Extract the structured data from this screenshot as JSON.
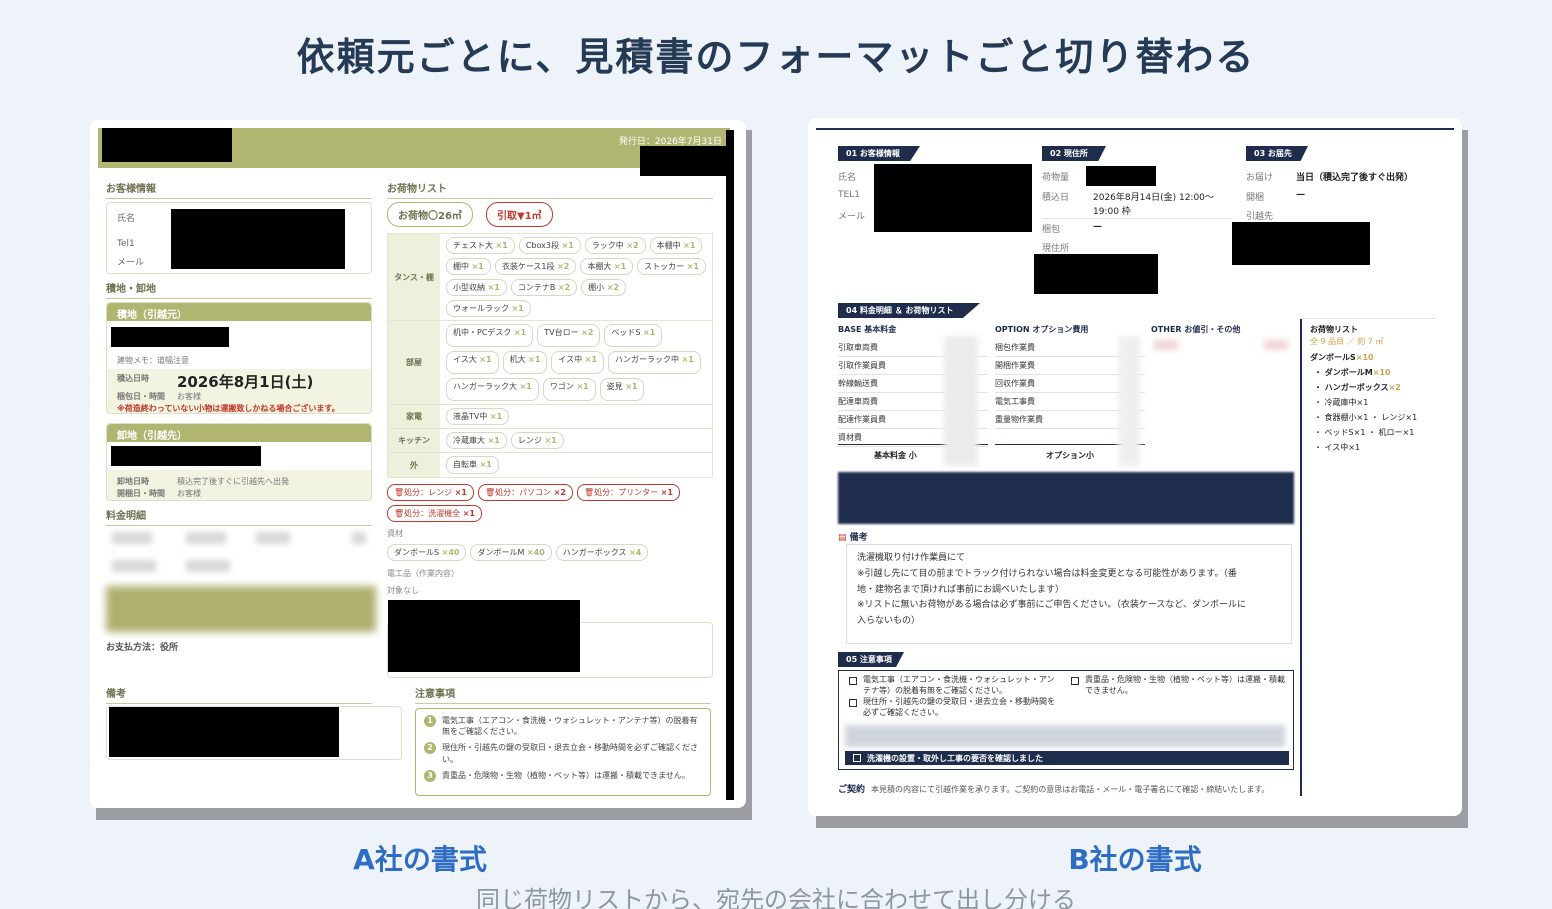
{
  "headline": "依頼元ごとに、見積書のフォーマットごと切り替わる",
  "caption_a": "A社の書式",
  "caption_b": "B社の書式",
  "subline": "同じ荷物リストから、宛先の会社に合わせて出し分ける",
  "colors": {
    "olive": "#b1b572",
    "navy": "#1f2d4d",
    "caption_blue": "#2e6dc4",
    "warn_red": "#c0392b"
  },
  "a": {
    "issue_date": "発行日：2026年7月31日",
    "customer_title": "お客様情報",
    "name_label": "氏名",
    "tel_label": "Tel1",
    "mail_label": "メール",
    "loading_title": "積地・卸地",
    "origin_title": "積地（引越元）",
    "memo": "建物メモ：道幅注意",
    "load_datetime_label": "積込日時",
    "load_date": "2026年8月1日(土)",
    "pack_label": "梱包日・時間",
    "pack_value": "お客様",
    "warning": "※荷造終わっていない小物は運搬致しかねる場合ございます。",
    "dest_title": "卸地（引越先）",
    "unload_label": "卸地日時",
    "unload_value": "積込完了後すぐに引越先へ出発",
    "unpack_label": "開梱日・時間",
    "unpack_value": "お客様",
    "fee_title": "料金明細",
    "payment": "お支払方法：役所",
    "remarks_title": "備考",
    "cargo_title": "お荷物リスト",
    "pill_cargo": "お荷物〇26㎥",
    "pill_reduce": "引取▼1㎥",
    "grid": [
      {
        "category": "タンス・棚",
        "items": [
          {
            "name": "チェスト大",
            "qty": "×1"
          },
          {
            "name": "Cbox3段",
            "qty": "×1"
          },
          {
            "name": "ラック中",
            "qty": "×2"
          },
          {
            "name": "本棚中",
            "qty": "×1"
          },
          {
            "name": "棚中",
            "qty": "×1"
          },
          {
            "name": "衣装ケース1段",
            "qty": "×2"
          },
          {
            "name": "本棚大",
            "qty": "×1"
          },
          {
            "name": "ストッカー",
            "qty": "×1"
          },
          {
            "name": "小型収納",
            "qty": "×1"
          },
          {
            "name": "コンテナB",
            "qty": "×2"
          },
          {
            "name": "棚小",
            "qty": "×2"
          },
          {
            "name": "ウォールラック",
            "qty": "×1"
          }
        ]
      },
      {
        "category": "部屋",
        "items": [
          {
            "name": "机中・PCデスク",
            "qty": "×1"
          },
          {
            "name": "TV台ロー",
            "qty": "×2"
          },
          {
            "name": "ベッドS",
            "qty": "×1"
          },
          {
            "name": "イス大",
            "qty": "×1"
          },
          {
            "name": "机大",
            "qty": "×1"
          },
          {
            "name": "イス中",
            "qty": "×1"
          },
          {
            "name": "ハンガーラック中",
            "qty": "×1"
          },
          {
            "name": "ハンガーラック大",
            "qty": "×1"
          },
          {
            "name": "ワゴン",
            "qty": "×1"
          },
          {
            "name": "姿見",
            "qty": "×1"
          }
        ]
      },
      {
        "category": "家電",
        "items": [
          {
            "name": "液晶TV中",
            "qty": "×1"
          }
        ]
      },
      {
        "category": "キッチン",
        "items": [
          {
            "name": "冷蔵庫大",
            "qty": "×1"
          },
          {
            "name": "レンジ",
            "qty": "×1"
          }
        ]
      },
      {
        "category": "外",
        "items": [
          {
            "name": "自転車",
            "qty": "×1"
          }
        ]
      }
    ],
    "disposal": [
      {
        "name": "🗑処分：レンジ",
        "qty": "×1"
      },
      {
        "name": "🗑処分：パソコン",
        "qty": "×2"
      },
      {
        "name": "🗑処分：プリンター",
        "qty": "×1"
      },
      {
        "name": "🗑処分：洗濯機全",
        "qty": "×1"
      }
    ],
    "materials_label": "資材",
    "materials": [
      {
        "name": "ダンボールS",
        "qty": "×40"
      },
      {
        "name": "ダンボールM",
        "qty": "×40"
      },
      {
        "name": "ハンガーボックス",
        "qty": "×4"
      }
    ],
    "electric_label": "電工品（作業内容）",
    "electric_value": "対象なし",
    "caution_title": "注意事項",
    "cautions": [
      {
        "n": "1",
        "text": "電気工事（エアコン・食洗機・ウォシュレット・アンテナ等）の脱着有無をご確認ください。"
      },
      {
        "n": "2",
        "text": "現住所・引越先の鍵の受取日・退去立会・移動時間を必ずご確認ください。"
      },
      {
        "n": "3",
        "text": "貴重品・危険物・生物（植物・ペット等）は運搬・積載できません。"
      }
    ]
  },
  "b": {
    "tag1": "01 お客様情報",
    "tag2": "02 現住所",
    "tag3": "03 お届先",
    "name_label": "氏名",
    "tel_label": "TEL1",
    "mail_label": "メール",
    "cargo_amount_label": "荷物量",
    "load_label": "積込日",
    "load_value_1": "2026年8月14日(金) 12:00〜",
    "load_value_2": "19:00 枠",
    "pack_label": "梱包",
    "pack_value": "—",
    "current_label": "現住所",
    "deliver_label": "お届け",
    "deliver_value": "当日（積込完了後すぐ出発）",
    "unpack_label": "開梱",
    "unpack_value": "—",
    "dest_label": "引越先",
    "tag4": "04 料金明細 ＆ お荷物リスト",
    "base_head": "BASE 基本料金",
    "base_items": [
      "引取車両費",
      "引取作業員費",
      "幹線輸送費",
      "配達車両費",
      "配達作業員費",
      "資材費"
    ],
    "base_sub": "基本料金 小",
    "option_head": "OPTION オプション費用",
    "option_items": [
      "梱包作業費",
      "開梱作業費",
      "回収作業費",
      "電気工事費",
      "重量物作業費"
    ],
    "option_sub": "オプション小",
    "other_head": "OTHER お値引・その他",
    "remarks_title": "備考",
    "remarks_lines": [
      "洗濯機取り付け作業員にて",
      "※引越し先にて目の前までトラック付けられない場合は料金変更となる可能性があります。（番",
      "地・建物名まで頂ければ事前にお調べいたします）",
      "※リストに無いお荷物がある場合は必ず事前にご申告ください。（衣装ケースなど、ダンボールに",
      "入らないもの）"
    ],
    "tag5": "05 注意事項",
    "caution_1": "電気工事（エアコン・食洗機・ウォシュレット・アンテナ等）の脱着有無をご確認ください。",
    "caution_2": "現住所・引越先の鍵の受取日・退去立会・移動時間を必ずご確認ください。",
    "caution_3": "貴重品・危険物・生物（植物・ペット等）は運搬・積載できません。",
    "caution_bar": "洗濯機の設置・取外し工事の要否を確認しました",
    "list_title": "お荷物リスト",
    "list_total": "全 9 品目 ／ 約 7 ㎥",
    "list_items": [
      {
        "name": "ダンボールS",
        "qty": "×10"
      },
      {
        "name": "ダンボールM",
        "qty": "×10"
      },
      {
        "name": "ハンガーボックス",
        "qty": "×2"
      },
      {
        "name": "冷蔵庫中×1",
        "qty": ""
      },
      {
        "name": "食器棚小×1 ・ レンジ×1",
        "qty": ""
      },
      {
        "name": "ベッドS×1 ・ 机ロー×1",
        "qty": ""
      },
      {
        "name": "イス中×1",
        "qty": ""
      }
    ],
    "contract_title": "ご契約",
    "contract_text": "本見積の内容にて引越作業を承ります。ご契約の意思はお電話・メール・電子署名にて確認・締結いたします。"
  }
}
